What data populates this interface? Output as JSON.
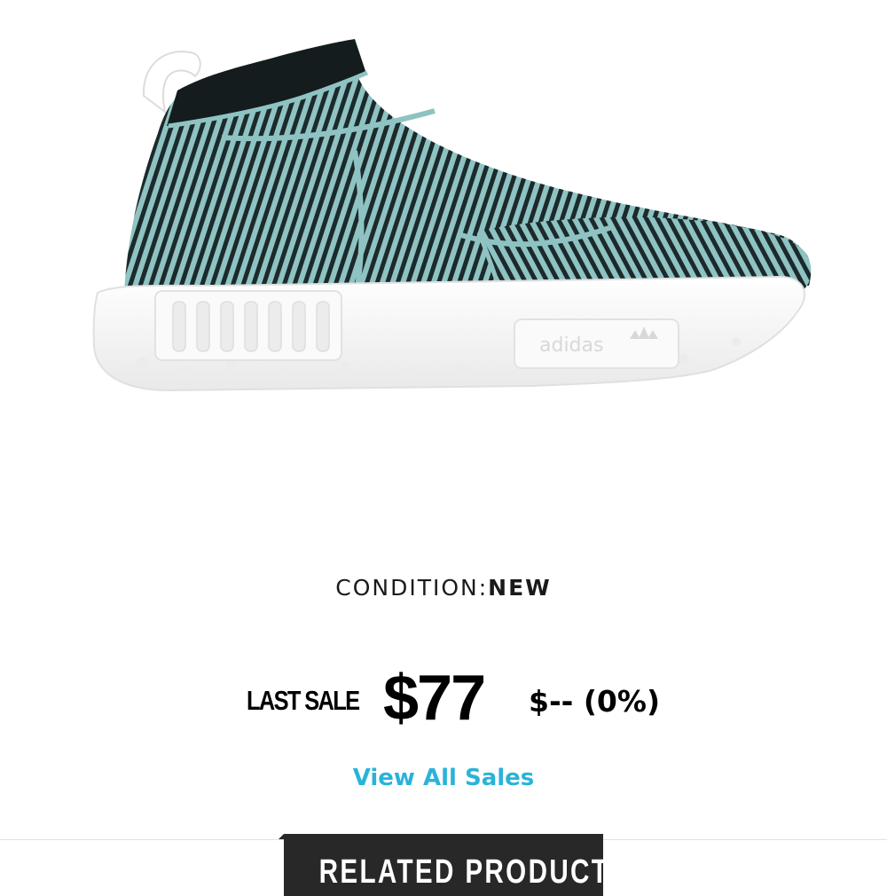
{
  "product": {
    "image_alt": "adidas NMD CS1 Parley sneaker",
    "brand_logo_text": "adidas",
    "colors": {
      "upper_stripe_dark": "#1c2a2b",
      "upper_stripe_light": "#8fc3c3",
      "collar": "#141c1d",
      "sole": "#f4f4f4"
    }
  },
  "condition": {
    "label": "CONDITION:",
    "value": "NEW"
  },
  "last_sale": {
    "label": "LAST SALE",
    "price": "$77",
    "change": "$-- (0%)"
  },
  "links": {
    "view_all_sales": "View All Sales"
  },
  "tabs": {
    "related_products": "RELATED PRODUCTS"
  },
  "colors": {
    "link": "#29b3d9",
    "tab_bg": "#282828"
  }
}
